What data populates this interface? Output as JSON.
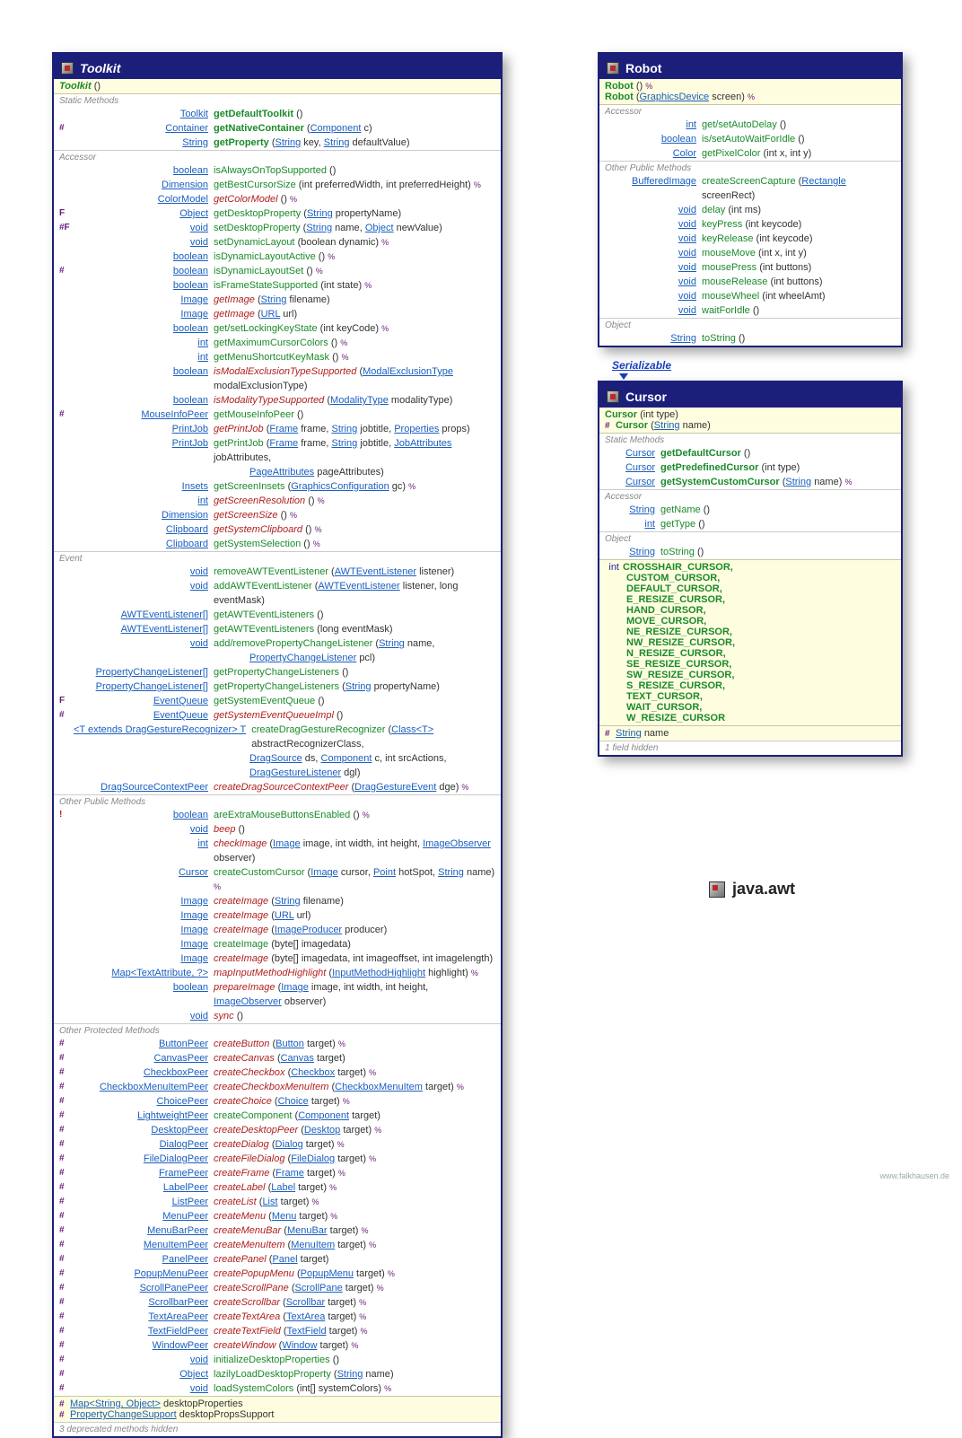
{
  "package": "java.awt",
  "credit": "www.falkhausen.de",
  "toolkit": {
    "title": "Toolkit",
    "ctors": [
      {
        "name": "Toolkit",
        "params": "()",
        "abstract": true
      }
    ],
    "groups": [
      {
        "label": "Static Methods",
        "rows": [
          {
            "mod": "",
            "ret": "Toolkit",
            "m": "getDefaultToolkit",
            "mc": "st",
            "p": "()"
          },
          {
            "mod": "#",
            "ret": "Container",
            "m": "getNativeContainer",
            "mc": "st",
            "p": "(Component c)"
          },
          {
            "mod": "",
            "ret": "String",
            "m": "getProperty",
            "mc": "st",
            "p": "(String key, String defaultValue)"
          }
        ]
      },
      {
        "label": "Accessor",
        "rows": [
          {
            "mod": "",
            "ret": "boolean",
            "m": "isAlwaysOnTopSupported",
            "mc": "g",
            "p": "()"
          },
          {
            "mod": "",
            "ret": "Dimension",
            "m": "getBestCursorSize",
            "mc": "g",
            "p": "(int preferredWidth, int preferredHeight)",
            "tail": "%"
          },
          {
            "mod": "",
            "ret": "ColorModel",
            "m": "getColorModel",
            "mc": "ab",
            "p": "()",
            "tail": "%"
          },
          {
            "mod": "F",
            "ret": "Object",
            "m": "getDesktopProperty",
            "mc": "g",
            "p": "(String propertyName)"
          },
          {
            "mod": "#F",
            "ret": "void",
            "m": "setDesktopProperty",
            "mc": "g",
            "p": "(String name, Object newValue)"
          },
          {
            "mod": "",
            "ret": "void",
            "m": "setDynamicLayout",
            "mc": "g",
            "p": "(boolean dynamic)",
            "tail": "%"
          },
          {
            "mod": "",
            "ret": "boolean",
            "m": "isDynamicLayoutActive",
            "mc": "g",
            "p": "()",
            "tail": "%"
          },
          {
            "mod": "#",
            "ret": "boolean",
            "m": "isDynamicLayoutSet",
            "mc": "g",
            "p": "()",
            "tail": "%"
          },
          {
            "mod": "",
            "ret": "boolean",
            "m": "isFrameStateSupported",
            "mc": "g",
            "p": "(int state)",
            "tail": "%"
          },
          {
            "mod": "",
            "ret": "Image",
            "m": "getImage",
            "mc": "ab",
            "p": "(String filename)"
          },
          {
            "mod": "",
            "ret": "Image",
            "m": "getImage",
            "mc": "ab",
            "p": "(URL url)"
          },
          {
            "mod": "",
            "ret": "boolean",
            "m": "get/setLockingKeyState",
            "mc": "g",
            "p": "(int keyCode)",
            "tail": "%"
          },
          {
            "mod": "",
            "ret": "int",
            "m": "getMaximumCursorColors",
            "mc": "g",
            "p": "()",
            "tail": "%"
          },
          {
            "mod": "",
            "ret": "int",
            "m": "getMenuShortcutKeyMask",
            "mc": "g",
            "p": "()",
            "tail": "%"
          },
          {
            "mod": "",
            "ret": "boolean",
            "m": "isModalExclusionTypeSupported",
            "mc": "ab",
            "p": "(ModalExclusionType modalExclusionType)"
          },
          {
            "mod": "",
            "ret": "boolean",
            "m": "isModalityTypeSupported",
            "mc": "ab",
            "p": "(ModalityType modalityType)"
          },
          {
            "mod": "#",
            "ret": "MouseInfoPeer",
            "m": "getMouseInfoPeer",
            "mc": "g",
            "p": "()"
          },
          {
            "mod": "",
            "ret": "PrintJob",
            "m": "getPrintJob",
            "mc": "ab",
            "p": "(Frame frame, String jobtitle, Properties props)"
          },
          {
            "mod": "",
            "ret": "PrintJob",
            "m": "getPrintJob",
            "mc": "g",
            "p": "(Frame frame, String jobtitle, JobAttributes jobAttributes,",
            "cont": "PageAttributes pageAttributes)"
          },
          {
            "mod": "",
            "ret": "Insets",
            "m": "getScreenInsets",
            "mc": "g",
            "p": "(GraphicsConfiguration gc)",
            "tail": "%"
          },
          {
            "mod": "",
            "ret": "int",
            "m": "getScreenResolution",
            "mc": "ab",
            "p": "()",
            "tail": "%"
          },
          {
            "mod": "",
            "ret": "Dimension",
            "m": "getScreenSize",
            "mc": "ab",
            "p": "()",
            "tail": "%"
          },
          {
            "mod": "",
            "ret": "Clipboard",
            "m": "getSystemClipboard",
            "mc": "ab",
            "p": "()",
            "tail": "%"
          },
          {
            "mod": "",
            "ret": "Clipboard",
            "m": "getSystemSelection",
            "mc": "g",
            "p": "()",
            "tail": "%"
          }
        ]
      },
      {
        "label": "Event",
        "rows": [
          {
            "mod": "",
            "ret": "void",
            "m": "removeAWTEventListener",
            "mc": "g",
            "p": "(AWTEventListener listener)"
          },
          {
            "mod": "",
            "ret": "void",
            "m": "addAWTEventListener",
            "mc": "g",
            "p": "(AWTEventListener listener, long eventMask)"
          },
          {
            "mod": "",
            "ret": "AWTEventListener[]",
            "m": "getAWTEventListeners",
            "mc": "g",
            "p": "()"
          },
          {
            "mod": "",
            "ret": "AWTEventListener[]",
            "m": "getAWTEventListeners",
            "mc": "g",
            "p": "(long eventMask)"
          },
          {
            "mod": "",
            "ret": "void",
            "m": "add/removePropertyChangeListener",
            "mc": "g",
            "p": "(String name,",
            "cont": "PropertyChangeListener pcl)"
          },
          {
            "mod": "",
            "ret": "PropertyChangeListener[]",
            "m": "getPropertyChangeListeners",
            "mc": "g",
            "p": "()"
          },
          {
            "mod": "",
            "ret": "PropertyChangeListener[]",
            "m": "getPropertyChangeListeners",
            "mc": "g",
            "p": "(String propertyName)"
          },
          {
            "mod": "F",
            "ret": "EventQueue",
            "m": "getSystemEventQueue",
            "mc": "g",
            "p": "()"
          },
          {
            "mod": "#",
            "ret": "EventQueue",
            "m": "getSystemEventQueueImpl",
            "mc": "ab",
            "p": "()"
          },
          {
            "mod": "",
            "ret": "<T extends DragGestureRecognizer> T",
            "m": "createDragGestureRecognizer",
            "mc": "g",
            "p": "(Class<T> abstractRecognizerClass,",
            "cont": "DragSource ds, Component c, int srcActions, DragGestureListener dgl)",
            "retwide": true
          },
          {
            "mod": "",
            "ret": "DragSourceContextPeer",
            "m": "createDragSourceContextPeer",
            "mc": "ab",
            "p": "(DragGestureEvent dge)",
            "tail": "%"
          }
        ]
      },
      {
        "label": "Other Public Methods",
        "rows": [
          {
            "mod": "!",
            "modcolor": "#c02020",
            "ret": "boolean",
            "m": "areExtraMouseButtonsEnabled",
            "mc": "g",
            "p": "()",
            "tail": "%"
          },
          {
            "mod": "",
            "ret": "void",
            "m": "beep",
            "mc": "ab",
            "p": "()"
          },
          {
            "mod": "",
            "ret": "int",
            "m": "checkImage",
            "mc": "ab",
            "p": "(Image image, int width, int height, ImageObserver observer)"
          },
          {
            "mod": "",
            "ret": "Cursor",
            "m": "createCustomCursor",
            "mc": "g",
            "p": "(Image cursor, Point hotSpot, String name)",
            "tail": "%"
          },
          {
            "mod": "",
            "ret": "Image",
            "m": "createImage",
            "mc": "ab",
            "p": "(String filename)"
          },
          {
            "mod": "",
            "ret": "Image",
            "m": "createImage",
            "mc": "ab",
            "p": "(URL url)"
          },
          {
            "mod": "",
            "ret": "Image",
            "m": "createImage",
            "mc": "ab",
            "p": "(ImageProducer producer)"
          },
          {
            "mod": "",
            "ret": "Image",
            "m": "createImage",
            "mc": "g",
            "p": "(byte[] imagedata)"
          },
          {
            "mod": "",
            "ret": "Image",
            "m": "createImage",
            "mc": "ab",
            "p": "(byte[] imagedata, int imageoffset, int imagelength)"
          },
          {
            "mod": "",
            "ret": "Map<TextAttribute, ?>",
            "m": "mapInputMethodHighlight",
            "mc": "ab",
            "p": "(InputMethodHighlight highlight)",
            "tail": "%"
          },
          {
            "mod": "",
            "ret": "boolean",
            "m": "prepareImage",
            "mc": "ab",
            "p": "(Image image, int width, int height, ImageObserver observer)"
          },
          {
            "mod": "",
            "ret": "void",
            "m": "sync",
            "mc": "ab",
            "p": "()"
          }
        ]
      },
      {
        "label": "Other Protected Methods",
        "rows": [
          {
            "mod": "#",
            "ret": "ButtonPeer",
            "m": "createButton",
            "mc": "ab",
            "p": "(Button target)",
            "tail": "%"
          },
          {
            "mod": "#",
            "ret": "CanvasPeer",
            "m": "createCanvas",
            "mc": "ab",
            "p": "(Canvas target)"
          },
          {
            "mod": "#",
            "ret": "CheckboxPeer",
            "m": "createCheckbox",
            "mc": "ab",
            "p": "(Checkbox target)",
            "tail": "%"
          },
          {
            "mod": "#",
            "ret": "CheckboxMenuItemPeer",
            "m": "createCheckboxMenuItem",
            "mc": "ab",
            "p": "(CheckboxMenuItem target)",
            "tail": "%"
          },
          {
            "mod": "#",
            "ret": "ChoicePeer",
            "m": "createChoice",
            "mc": "ab",
            "p": "(Choice target)",
            "tail": "%"
          },
          {
            "mod": "#",
            "ret": "LightweightPeer",
            "m": "createComponent",
            "mc": "g",
            "p": "(Component target)"
          },
          {
            "mod": "#",
            "ret": "DesktopPeer",
            "m": "createDesktopPeer",
            "mc": "ab",
            "p": "(Desktop target)",
            "tail": "%"
          },
          {
            "mod": "#",
            "ret": "DialogPeer",
            "m": "createDialog",
            "mc": "ab",
            "p": "(Dialog target)",
            "tail": "%"
          },
          {
            "mod": "#",
            "ret": "FileDialogPeer",
            "m": "createFileDialog",
            "mc": "ab",
            "p": "(FileDialog target)",
            "tail": "%"
          },
          {
            "mod": "#",
            "ret": "FramePeer",
            "m": "createFrame",
            "mc": "ab",
            "p": "(Frame target)",
            "tail": "%"
          },
          {
            "mod": "#",
            "ret": "LabelPeer",
            "m": "createLabel",
            "mc": "ab",
            "p": "(Label target)",
            "tail": "%"
          },
          {
            "mod": "#",
            "ret": "ListPeer",
            "m": "createList",
            "mc": "ab",
            "p": "(List target)",
            "tail": "%"
          },
          {
            "mod": "#",
            "ret": "MenuPeer",
            "m": "createMenu",
            "mc": "ab",
            "p": "(Menu target)",
            "tail": "%"
          },
          {
            "mod": "#",
            "ret": "MenuBarPeer",
            "m": "createMenuBar",
            "mc": "ab",
            "p": "(MenuBar target)",
            "tail": "%"
          },
          {
            "mod": "#",
            "ret": "MenuItemPeer",
            "m": "createMenuItem",
            "mc": "ab",
            "p": "(MenuItem target)",
            "tail": "%"
          },
          {
            "mod": "#",
            "ret": "PanelPeer",
            "m": "createPanel",
            "mc": "ab",
            "p": "(Panel target)"
          },
          {
            "mod": "#",
            "ret": "PopupMenuPeer",
            "m": "createPopupMenu",
            "mc": "ab",
            "p": "(PopupMenu target)",
            "tail": "%"
          },
          {
            "mod": "#",
            "ret": "ScrollPanePeer",
            "m": "createScrollPane",
            "mc": "ab",
            "p": "(ScrollPane target)",
            "tail": "%"
          },
          {
            "mod": "#",
            "ret": "ScrollbarPeer",
            "m": "createScrollbar",
            "mc": "ab",
            "p": "(Scrollbar target)",
            "tail": "%"
          },
          {
            "mod": "#",
            "ret": "TextAreaPeer",
            "m": "createTextArea",
            "mc": "ab",
            "p": "(TextArea target)",
            "tail": "%"
          },
          {
            "mod": "#",
            "ret": "TextFieldPeer",
            "m": "createTextField",
            "mc": "ab",
            "p": "(TextField target)",
            "tail": "%"
          },
          {
            "mod": "#",
            "ret": "WindowPeer",
            "m": "createWindow",
            "mc": "ab",
            "p": "(Window target)",
            "tail": "%"
          },
          {
            "mod": "#",
            "ret": "void",
            "m": "initializeDesktopProperties",
            "mc": "g",
            "p": "()"
          },
          {
            "mod": "#",
            "ret": "Object",
            "m": "lazilyLoadDesktopProperty",
            "mc": "g",
            "p": "(String name)"
          },
          {
            "mod": "#",
            "ret": "void",
            "m": "loadSystemColors",
            "mc": "g",
            "p": "(int[] systemColors)",
            "tail": "%"
          }
        ]
      }
    ],
    "fields": [
      {
        "mod": "#",
        "type": "Map<String, Object>",
        "name": "desktopProperties"
      },
      {
        "mod": "#",
        "type": "PropertyChangeSupport",
        "name": "desktopPropsSupport"
      }
    ],
    "footnote": "3 deprecated methods hidden"
  },
  "robot": {
    "title": "Robot",
    "ctors": [
      {
        "name": "Robot",
        "params": "()",
        "tail": "%"
      },
      {
        "name": "Robot",
        "params": "(GraphicsDevice screen)",
        "tail": "%"
      }
    ],
    "groups": [
      {
        "label": "Accessor",
        "rows": [
          {
            "ret": "int",
            "m": "get/setAutoDelay",
            "mc": "g",
            "p": "()"
          },
          {
            "ret": "boolean",
            "m": "is/setAutoWaitForIdle",
            "mc": "g",
            "p": "()"
          },
          {
            "ret": "Color",
            "m": "getPixelColor",
            "mc": "g",
            "p": "(int x, int y)"
          }
        ]
      },
      {
        "label": "Other Public Methods",
        "rows": [
          {
            "ret": "BufferedImage",
            "m": "createScreenCapture",
            "mc": "g",
            "p": "(Rectangle screenRect)"
          },
          {
            "ret": "void",
            "m": "delay",
            "mc": "g",
            "p": "(int ms)"
          },
          {
            "ret": "void",
            "m": "keyPress",
            "mc": "g",
            "p": "(int keycode)"
          },
          {
            "ret": "void",
            "m": "keyRelease",
            "mc": "g",
            "p": "(int keycode)"
          },
          {
            "ret": "void",
            "m": "mouseMove",
            "mc": "g",
            "p": "(int x, int y)"
          },
          {
            "ret": "void",
            "m": "mousePress",
            "mc": "g",
            "p": "(int buttons)"
          },
          {
            "ret": "void",
            "m": "mouseRelease",
            "mc": "g",
            "p": "(int buttons)"
          },
          {
            "ret": "void",
            "m": "mouseWheel",
            "mc": "g",
            "p": "(int wheelAmt)"
          },
          {
            "ret": "void",
            "m": "waitForIdle",
            "mc": "g",
            "p": "()"
          }
        ]
      },
      {
        "label": "Object",
        "rows": [
          {
            "ret": "String",
            "m": "toString",
            "mc": "g",
            "p": "()"
          }
        ]
      }
    ]
  },
  "cursor": {
    "title": "Cursor",
    "implements": "Serializable",
    "ctors": [
      {
        "mod": "",
        "name": "Cursor",
        "params": "(int type)"
      },
      {
        "mod": "#",
        "name": "Cursor",
        "params": "(String name)"
      }
    ],
    "groups": [
      {
        "label": "Static Methods",
        "rows": [
          {
            "ret": "Cursor",
            "m": "getDefaultCursor",
            "mc": "st",
            "p": "()"
          },
          {
            "ret": "Cursor",
            "m": "getPredefinedCursor",
            "mc": "st",
            "p": "(int type)"
          },
          {
            "ret": "Cursor",
            "m": "getSystemCustomCursor",
            "mc": "st",
            "p": "(String name)",
            "tail": "%"
          }
        ]
      },
      {
        "label": "Accessor",
        "rows": [
          {
            "ret": "String",
            "m": "getName",
            "mc": "g",
            "p": "()"
          },
          {
            "ret": "int",
            "m": "getType",
            "mc": "g",
            "p": "()"
          }
        ]
      },
      {
        "label": "Object",
        "rows": [
          {
            "ret": "String",
            "m": "toString",
            "mc": "g",
            "p": "()"
          }
        ]
      }
    ],
    "constants": {
      "type": "int",
      "list": [
        "CROSSHAIR_CURSOR",
        "CUSTOM_CURSOR",
        "DEFAULT_CURSOR",
        "E_RESIZE_CURSOR",
        "HAND_CURSOR",
        "MOVE_CURSOR",
        "NE_RESIZE_CURSOR",
        "NW_RESIZE_CURSOR",
        "N_RESIZE_CURSOR",
        "SE_RESIZE_CURSOR",
        "SW_RESIZE_CURSOR",
        "S_RESIZE_CURSOR",
        "TEXT_CURSOR",
        "WAIT_CURSOR",
        "W_RESIZE_CURSOR"
      ]
    },
    "fields": [
      {
        "mod": "#",
        "type": "String",
        "name": "name"
      }
    ],
    "footnote": "1 field hidden"
  }
}
